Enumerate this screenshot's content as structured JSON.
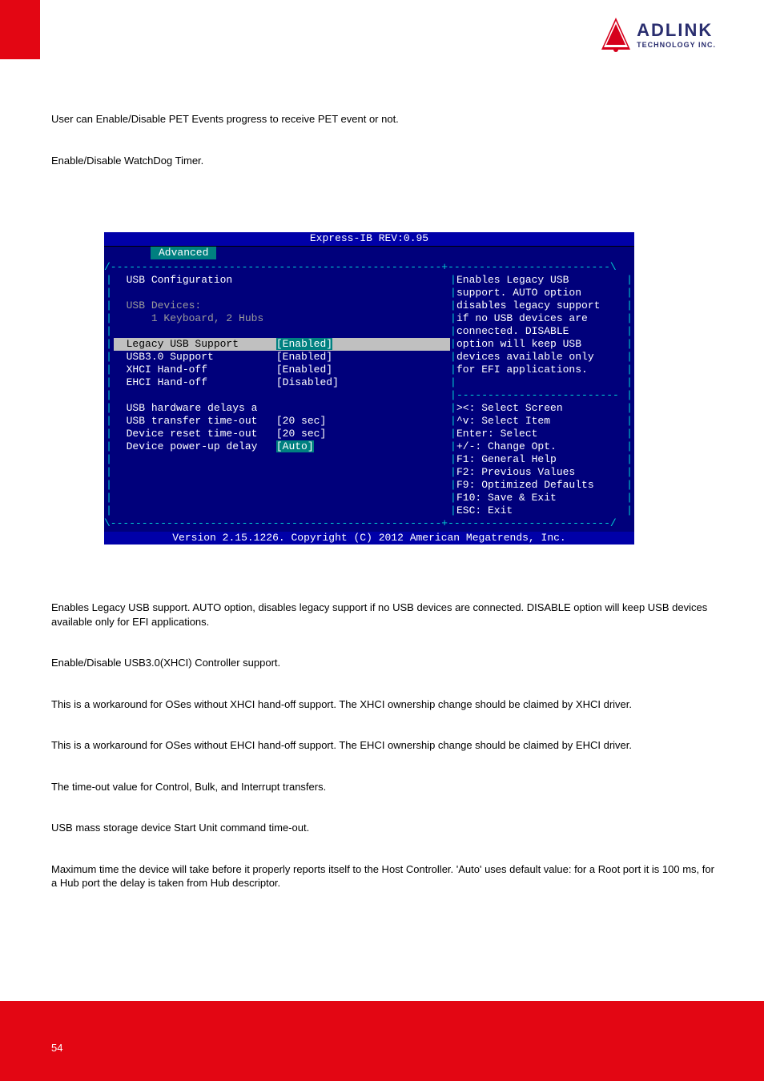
{
  "header": {
    "logo_top": "ADLINK",
    "logo_bot": "TECHNOLOGY INC."
  },
  "intro": {
    "p1": "User can Enable/Disable PET Events progress to receive PET event or not.",
    "p2": "Enable/Disable WatchDog Timer."
  },
  "bios": {
    "title": "Express-IB REV:0.95",
    "tab": "Advanced",
    "left": {
      "heading": "USB Configuration",
      "devices_label": "USB Devices:",
      "devices_line": "    1 Keyboard, 2 Hubs",
      "legacy_label": "Legacy USB Support",
      "legacy_val": "[Enabled]",
      "usb30_label": "USB3.0 Support",
      "usb30_val": "[Enabled]",
      "xhci_label": "XHCI Hand-off",
      "xhci_val": "[Enabled]",
      "ehci_label": "EHCI Hand-off",
      "ehci_val": "[Disabled]",
      "delays_label": "USB hardware delays a",
      "xfer_label": "USB transfer time-out",
      "xfer_val": "[20 sec]",
      "reset_label": "Device reset time-out",
      "reset_val": "[20 sec]",
      "power_label": "Device power-up delay",
      "power_val": "[Auto]"
    },
    "help": {
      "l1": "Enables Legacy USB",
      "l2": "support. AUTO option",
      "l3": "disables legacy support",
      "l4": "if no USB devices are",
      "l5": "connected. DISABLE",
      "l6": "option will keep USB",
      "l7": "devices available only",
      "l8": "for EFI applications."
    },
    "keys": {
      "k1": "><: Select Screen",
      "k2": "^v: Select Item",
      "k3": "Enter: Select",
      "k4": "+/-: Change Opt.",
      "k5": "F1: General Help",
      "k6": "F2: Previous Values",
      "k7": "F9: Optimized Defaults",
      "k8": "F10: Save & Exit",
      "k9": "ESC: Exit"
    },
    "footer": "Version 2.15.1226. Copyright (C) 2012 American Megatrends, Inc."
  },
  "desc": {
    "d1": "Enables Legacy USB support. AUTO option, disables legacy support if no USB devices are connected. DISABLE option will keep USB devices available only for EFI applications.",
    "d2": "Enable/Disable USB3.0(XHCI) Controller support.",
    "d3": "This is a workaround for OSes without XHCI hand-off support. The XHCI ownership change should be claimed by XHCI driver.",
    "d4": "This is a workaround for OSes without EHCI hand-off support. The EHCI ownership change should be claimed by EHCI driver.",
    "d5": "The time-out value for Control, Bulk, and Interrupt transfers.",
    "d6": "USB mass storage device Start Unit command time-out.",
    "d7": "Maximum time the device will take before it properly reports itself to the Host Controller. 'Auto' uses default value: for a Root port it is 100 ms, for a Hub port the delay is taken from Hub descriptor."
  },
  "footer": {
    "page": "54"
  }
}
